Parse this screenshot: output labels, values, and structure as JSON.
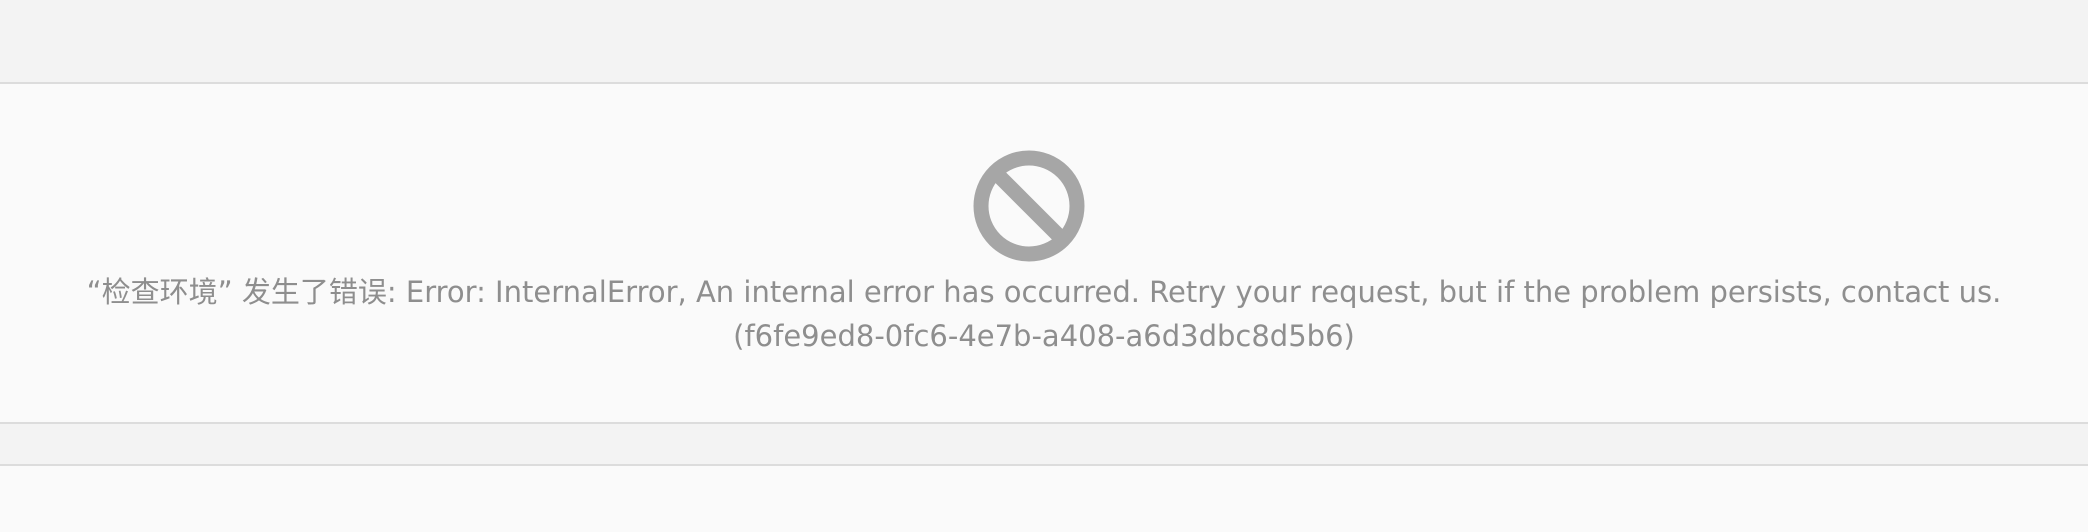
{
  "error": {
    "icon": "prohibited-icon",
    "message": "“检查环境” 发生了错误: Error: InternalError, An internal error has occurred. Retry your request, but if the problem persists, contact us.",
    "request_id": "(f6fe9ed8-0fc6-4e7b-a408-a6d3dbc8d5b6)",
    "text_color": "#8e8e8e",
    "icon_color": "#a6a6a6"
  }
}
